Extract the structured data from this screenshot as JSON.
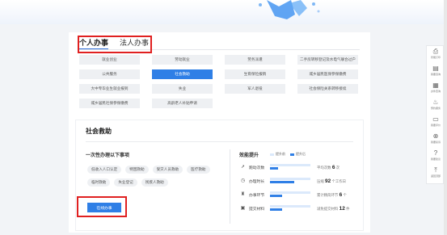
{
  "tabs": [
    {
      "label": "个人办事",
      "active": true
    },
    {
      "label": "法人办事",
      "active": false
    }
  ],
  "service_grid": [
    {
      "label": "就业创业"
    },
    {
      "label": "劳动就业"
    },
    {
      "label": "劳务派遣"
    },
    {
      "label": "二手房转移登记及水电气联合过户"
    },
    {
      "label": "公共服务"
    },
    {
      "label": "社会救助",
      "active": true
    },
    {
      "label": "生育保险报销"
    },
    {
      "label": "城乡居民医保参保缴费"
    },
    {
      "label": "大中专毕业生就业报到"
    },
    {
      "label": "失业"
    },
    {
      "label": "军人退役"
    },
    {
      "label": "社会保险关系转移接续"
    },
    {
      "label": "城乡居民社保参保缴费"
    },
    {
      "label": "高龄老人补贴申请"
    }
  ],
  "detail": {
    "title": "社会救助",
    "sub_title": "一次性办理以下事项",
    "items": [
      "低收入人口认定",
      "特困救助",
      "受灾人员救助",
      "医疗救助",
      "临时救助",
      "失业登记",
      "残疾人救助"
    ],
    "online_button": "在线办事",
    "efficiency": {
      "title": "效能提升",
      "legend_before": "提升前",
      "legend_after": "提升后",
      "metrics": [
        {
          "icon": "run-icon",
          "label": "跑动次数",
          "before_pct": 100,
          "after_pct": 20,
          "text_prefix": "平均次数",
          "value": "6",
          "text_suffix": "次"
        },
        {
          "icon": "clock-icon",
          "label": "办理时长",
          "before_pct": 100,
          "after_pct": 60,
          "text_prefix": "压缩",
          "value": "92",
          "text_suffix": "个工作日"
        },
        {
          "icon": "stamp-icon",
          "label": "办事环节",
          "before_pct": 100,
          "after_pct": 30,
          "text_prefix": "累计精简环节",
          "value": "6",
          "text_suffix": "个"
        },
        {
          "icon": "doc-icon",
          "label": "提交材料",
          "before_pct": 100,
          "after_pct": 30,
          "text_prefix": "减免提交材料",
          "value": "12",
          "text_suffix": "件"
        }
      ]
    }
  },
  "rightbar": [
    {
      "icon": "printer-icon",
      "glyph": "⎙",
      "label": "智能打印"
    },
    {
      "icon": "form-icon",
      "glyph": "▤",
      "label": "我要咨询"
    },
    {
      "icon": "office-icon",
      "glyph": "▦",
      "label": "办件查询"
    },
    {
      "icon": "lamp-icon",
      "glyph": "♨",
      "label": "预约服务"
    },
    {
      "icon": "monitor-icon",
      "glyph": "▭",
      "label": "我要评价"
    },
    {
      "icon": "compass-icon",
      "glyph": "⊗",
      "label": "我要投诉"
    },
    {
      "icon": "help-icon",
      "glyph": "?",
      "label": "我要建议"
    },
    {
      "icon": "top-icon",
      "glyph": "⤒",
      "label": "返回顶部"
    }
  ],
  "colors": {
    "accent": "#2f7fe6",
    "highlight": "#e02020",
    "bar_light": "#dbe9fb"
  }
}
